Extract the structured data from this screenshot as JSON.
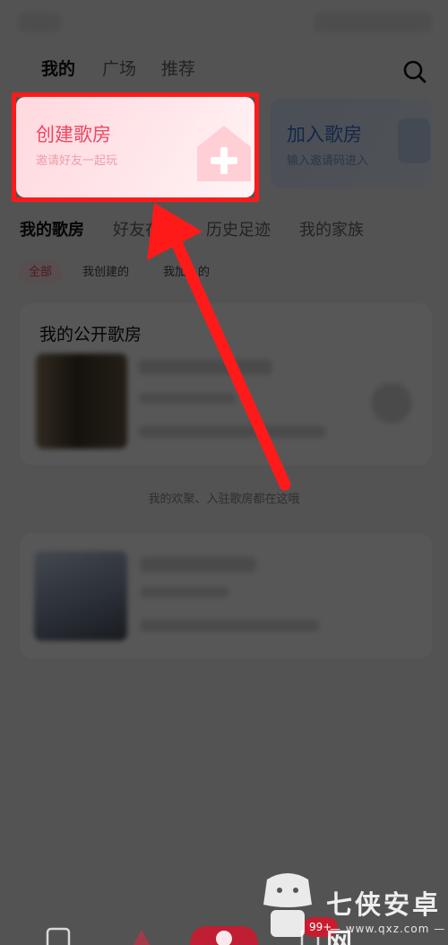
{
  "top_tabs": [
    {
      "label": "我的",
      "active": true
    },
    {
      "label": "广场",
      "active": false
    },
    {
      "label": "推荐",
      "active": false
    }
  ],
  "cards": {
    "create": {
      "title": "创建歌房",
      "subtitle": "邀请好友一起玩"
    },
    "join": {
      "title": "加入歌房",
      "subtitle": "输入邀请码进入"
    }
  },
  "section_tabs": [
    {
      "label": "我的歌房",
      "active": true
    },
    {
      "label": "好友在玩",
      "active": false
    },
    {
      "label": "历史足迹",
      "active": false
    },
    {
      "label": "我的家族",
      "active": false
    }
  ],
  "filters": [
    {
      "label": "全部",
      "active": true
    },
    {
      "label": "我创建的",
      "active": false
    },
    {
      "label": "我加入的",
      "active": false
    }
  ],
  "public_rooms": {
    "title": "我的公开歌房"
  },
  "note": "我的欢聚、入驻歌房都在这哦",
  "bottom_nav": {
    "badge": "99+"
  },
  "watermark": {
    "brand": "七侠安卓网",
    "url": "— www.qxz.com —"
  },
  "colors": {
    "accent": "#ee4660",
    "highlight": "#ff1a1a",
    "join_blue": "#3c72cf"
  }
}
